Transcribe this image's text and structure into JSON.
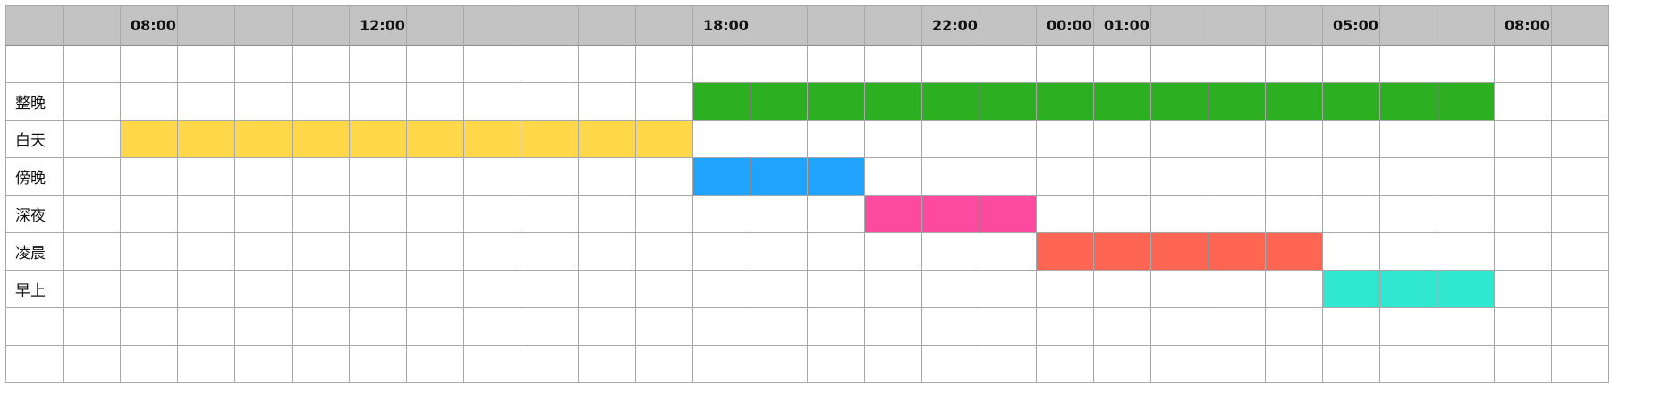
{
  "chart_data": {
    "type": "table",
    "time_labels": [
      "",
      "",
      "08:00",
      "",
      "",
      "",
      "12:00",
      "",
      "",
      "",
      "",
      "",
      "18:00",
      "",
      "",
      "",
      "22:00",
      "",
      "00:00",
      "01:00",
      "",
      "",
      "",
      "05:00",
      "",
      "",
      "08:00",
      ""
    ],
    "blank_rows_top": 1,
    "blank_rows_bottom": 2,
    "rows": [
      {
        "label": "整晚",
        "color": "#2daf22",
        "start": 12,
        "end": 25
      },
      {
        "label": "白天",
        "color": "#ffd84a",
        "start": 2,
        "end": 11
      },
      {
        "label": "傍晚",
        "color": "#1fa3fd",
        "start": 12,
        "end": 14
      },
      {
        "label": "深夜",
        "color": "#fd4aa1",
        "start": 15,
        "end": 17
      },
      {
        "label": "凌晨",
        "color": "#fe6653",
        "start": 18,
        "end": 22
      },
      {
        "label": "早上",
        "color": "#30e8cf",
        "start": 23,
        "end": 25
      }
    ]
  }
}
